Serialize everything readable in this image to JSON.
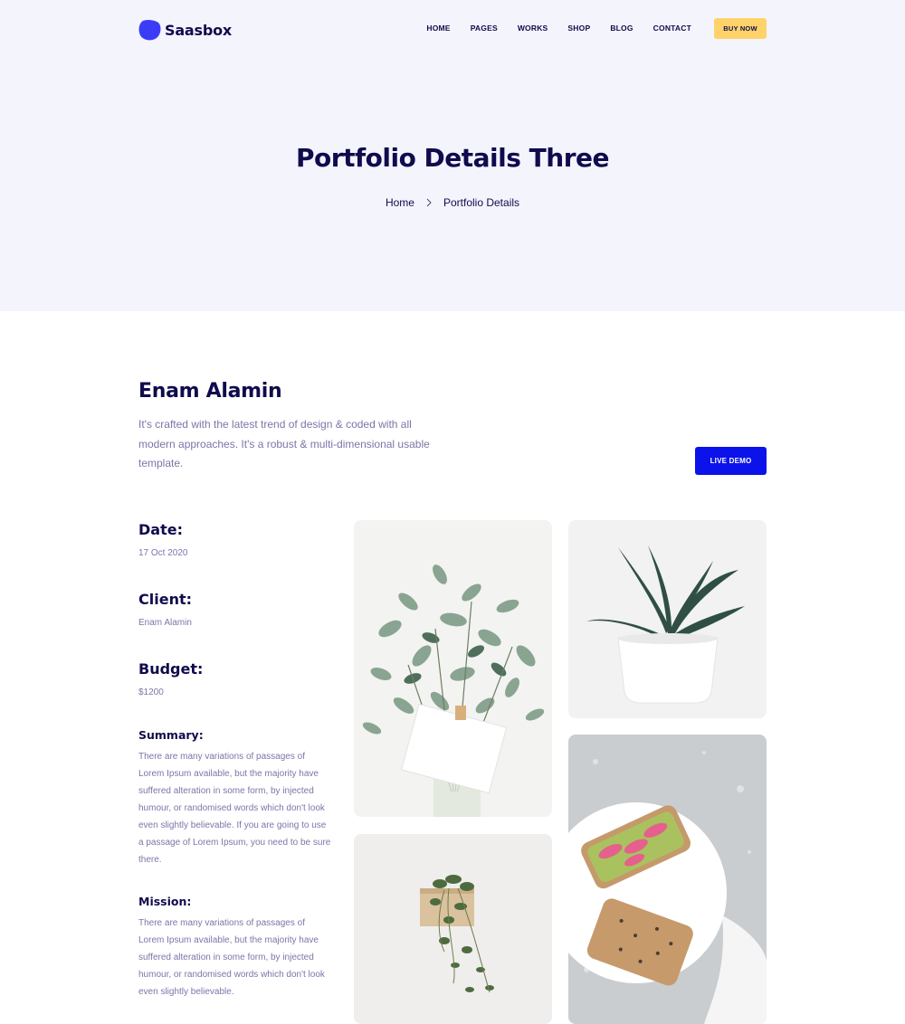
{
  "brand": {
    "name": "Saasbox",
    "accent": "#3a3df5"
  },
  "nav": {
    "items": [
      {
        "label": "HOME"
      },
      {
        "label": "PAGES"
      },
      {
        "label": "WORKS"
      },
      {
        "label": "SHOP"
      },
      {
        "label": "BLOG"
      },
      {
        "label": "CONTACT"
      }
    ],
    "buy_label": "BUY NOW"
  },
  "hero": {
    "title": "Portfolio Details Three",
    "breadcrumb": [
      "Home",
      "Portfolio Details"
    ]
  },
  "project": {
    "title": "Enam Alamin",
    "description": "It's crafted with the latest trend of design & coded with all modern approaches. It's a robust & multi-dimensional usable template.",
    "live_demo_label": "LIVE DEMO"
  },
  "details": {
    "date_label": "Date:",
    "date_value": "17 Oct 2020",
    "client_label": "Client:",
    "client_value": "Enam Alamin",
    "budget_label": "Budget:",
    "budget_value": "$1200",
    "summary_label": "Summary:",
    "summary_text": "There are many variations of passages of Lorem Ipsum available, but the majority have suffered alteration in some form, by injected humour, or randomised words which don't look even slightly believable. If you are going to use a passage of Lorem Ipsum, you need to be sure there.",
    "mission_label": "Mission:",
    "mission_text": "There are many variations of passages of Lorem Ipsum available, but the majority have suffered alteration in some form, by injected humour, or randomised words which don't look even slightly believable."
  },
  "colors": {
    "hero_bg": "#f4f4fd",
    "heading": "#0f0b4d",
    "body_text": "#7a76a8",
    "buy_button": "#ffd36a",
    "live_demo_button": "#0c12ea"
  },
  "icons": [
    "saasbox-logo-icon",
    "chevron-right-icon"
  ]
}
